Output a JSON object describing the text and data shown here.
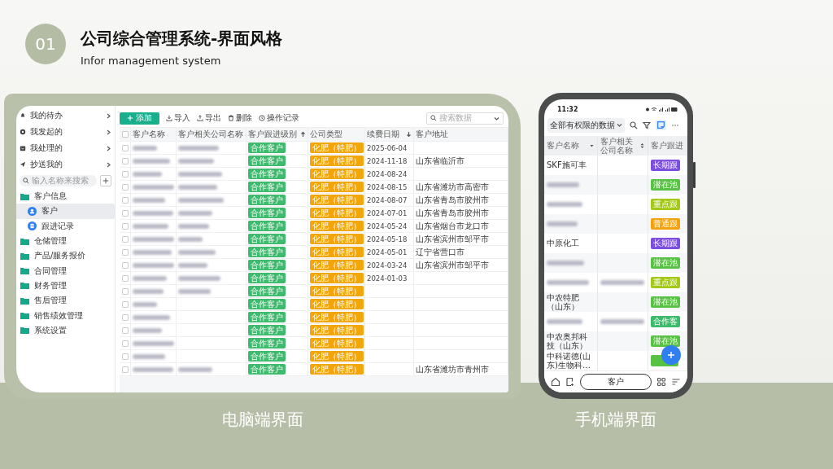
{
  "slide": {
    "number": "01",
    "title": "公司综合管理系统-界面风格",
    "subtitle": "Infor management system"
  },
  "desktop": {
    "caption": "电脑端界面",
    "sidebar": {
      "quick_items": [
        {
          "label": "我的待办",
          "kind": "bell"
        },
        {
          "label": "我发起的",
          "kind": "gear"
        },
        {
          "label": "我处理的",
          "kind": "inbox"
        },
        {
          "label": "抄送我的",
          "kind": "send"
        }
      ],
      "search": {
        "placeholder": "输入名称来搜索"
      },
      "tree": [
        {
          "label": "客户信息",
          "children": [
            {
              "label": "客户",
              "kind": "person",
              "selected": true
            },
            {
              "label": "跟进记录",
              "kind": "doc",
              "selected": false
            }
          ]
        },
        {
          "label": "仓储管理"
        },
        {
          "label": "产品/服务报价"
        },
        {
          "label": "合同管理"
        },
        {
          "label": "财务管理"
        },
        {
          "label": "售后管理"
        },
        {
          "label": "销售绩效管理"
        },
        {
          "label": "系统设置"
        }
      ]
    },
    "toolbar": {
      "add": "添加",
      "actions": [
        {
          "label": "导入",
          "kind": "import"
        },
        {
          "label": "导出",
          "kind": "export"
        },
        {
          "label": "删除",
          "kind": "delete"
        },
        {
          "label": "操作记录",
          "kind": "history"
        }
      ],
      "search": {
        "placeholder": "搜索数据"
      }
    },
    "table": {
      "header_checked": false,
      "columns": [
        {
          "label": "客户名称",
          "kind": "plain"
        },
        {
          "label": "客户相关公司名称",
          "kind": "plain"
        },
        {
          "label": "客户跟进级别",
          "kind": "asc"
        },
        {
          "label": "公司类型",
          "kind": "plain"
        },
        {
          "label": "续费日期",
          "kind": "desc"
        },
        {
          "label": "客户地址",
          "kind": "plain"
        }
      ],
      "rows": [
        {
          "checked": false,
          "name_blurred": true,
          "company_blurred": true,
          "level": "合作客户",
          "type": "化肥（特肥）",
          "date": "2025-06-04"
        },
        {
          "checked": false,
          "name_blurred": true,
          "company_blurred": true,
          "level": "合作客户",
          "type": "化肥（特肥）",
          "date": "2024-11-18",
          "address": "山东省临沂市"
        },
        {
          "checked": false,
          "name_blurred": true,
          "company_blurred": true,
          "level": "合作客户",
          "type": "化肥（特肥）",
          "date": "2024-08-24"
        },
        {
          "checked": false,
          "name_blurred": true,
          "company_blurred": true,
          "level": "合作客户",
          "type": "化肥（特肥）",
          "date": "2024-08-15",
          "address": "山东省潍坊市高密市"
        },
        {
          "checked": false,
          "name_blurred": true,
          "company_blurred": true,
          "level": "合作客户",
          "type": "化肥（特肥）",
          "date": "2024-08-07",
          "address": "山东省青岛市胶州市"
        },
        {
          "checked": false,
          "name_blurred": true,
          "company_blurred": true,
          "level": "合作客户",
          "type": "化肥（特肥）",
          "date": "2024-07-01",
          "address": "山东省青岛市胶州市"
        },
        {
          "checked": false,
          "name_blurred": true,
          "company_blurred": true,
          "level": "合作客户",
          "type": "化肥（特肥）",
          "date": "2024-05-24",
          "address": "山东省烟台市龙口市"
        },
        {
          "checked": false,
          "name_blurred": true,
          "company_blurred": true,
          "level": "合作客户",
          "type": "化肥（特肥）",
          "date": "2024-05-18",
          "address": "山东省滨州市邹平市"
        },
        {
          "checked": false,
          "name_blurred": true,
          "company_blurred": true,
          "level": "合作客户",
          "type": "化肥（特肥）",
          "date": "2024-05-01",
          "address": "辽宁省营口市"
        },
        {
          "checked": false,
          "name_blurred": true,
          "company_blurred": true,
          "level": "合作客户",
          "type": "化肥（特肥）",
          "date": "2024-03-24",
          "address": "山东省滨州市邹平市"
        },
        {
          "checked": false,
          "name_blurred": true,
          "company_blurred": true,
          "level": "合作客户",
          "type": "化肥（特肥）",
          "date": "2024-01-03"
        },
        {
          "checked": false,
          "name_blurred": true,
          "company_blurred": true,
          "level": "合作客户",
          "type": "化肥（特肥）"
        },
        {
          "checked": false,
          "name_blurred": true,
          "company_blurred": false,
          "level": "合作客户",
          "type": "化肥（特肥）"
        },
        {
          "checked": false,
          "name_blurred": true,
          "company_blurred": false,
          "level": "合作客户",
          "type": "化肥（特肥）"
        },
        {
          "checked": false,
          "name_blurred": true,
          "company_blurred": false,
          "level": "合作客户",
          "type": "化肥（特肥）"
        },
        {
          "checked": false,
          "name_blurred": true,
          "company_blurred": false,
          "level": "合作客户",
          "type": "化肥（特肥）"
        },
        {
          "checked": false,
          "name_blurred": true,
          "company_blurred": false,
          "level": "合作客户",
          "type": "化肥（特肥）"
        },
        {
          "checked": false,
          "name_blurred": true,
          "company_blurred": true,
          "level": "合作客户",
          "type": "化肥（特肥）",
          "address": "山东省潍坊市青州市"
        }
      ]
    }
  },
  "mobile": {
    "caption": "手机端界面",
    "status": {
      "time": "11:32"
    },
    "filter": "全部有权限的数据",
    "columns": [
      {
        "label": "客户名称",
        "kind": "dropdown"
      },
      {
        "label": "客户相关公司名称",
        "kind": "sort"
      },
      {
        "label": "客户跟进",
        "kind": "plain"
      }
    ],
    "rows": [
      {
        "name_blurred": false,
        "name": "SKF施可丰",
        "company_blurred": false,
        "tag": "长期跟",
        "color": "#7b4ee0"
      },
      {
        "name_blurred": true,
        "company_blurred": false,
        "tag": "潜在池",
        "color": "#58c244"
      },
      {
        "name_blurred": true,
        "company_blurred": false,
        "tag": "重点跟",
        "color": "#a3c816"
      },
      {
        "name_blurred": true,
        "company_blurred": false,
        "tag": "普通跟",
        "color": "#f4a20c"
      },
      {
        "name_blurred": false,
        "name": "中原化工",
        "company_blurred": false,
        "tag": "长期跟",
        "color": "#7b4ee0"
      },
      {
        "name_blurred": true,
        "company_blurred": false,
        "tag": "潜在池",
        "color": "#58c244"
      },
      {
        "name_blurred": true,
        "company_blurred": true,
        "tag": "重点跟",
        "color": "#a3c816"
      },
      {
        "name_blurred": false,
        "name": "中农特肥（山东）",
        "company_blurred": false,
        "tag": "潜在池",
        "color": "#58c244"
      },
      {
        "name_blurred": true,
        "company_blurred": true,
        "tag": "合作客",
        "color": "#3dbb6c"
      },
      {
        "name_blurred": false,
        "name": "中农奥邦科技（山东）",
        "company_blurred": false,
        "tag": "潜在池",
        "color": "#58c244"
      },
      {
        "name_blurred": false,
        "name": "中科诺德(山东)生物科…",
        "company_blurred": false,
        "color": "#58c244"
      }
    ],
    "bottom_tab": "客户"
  }
}
